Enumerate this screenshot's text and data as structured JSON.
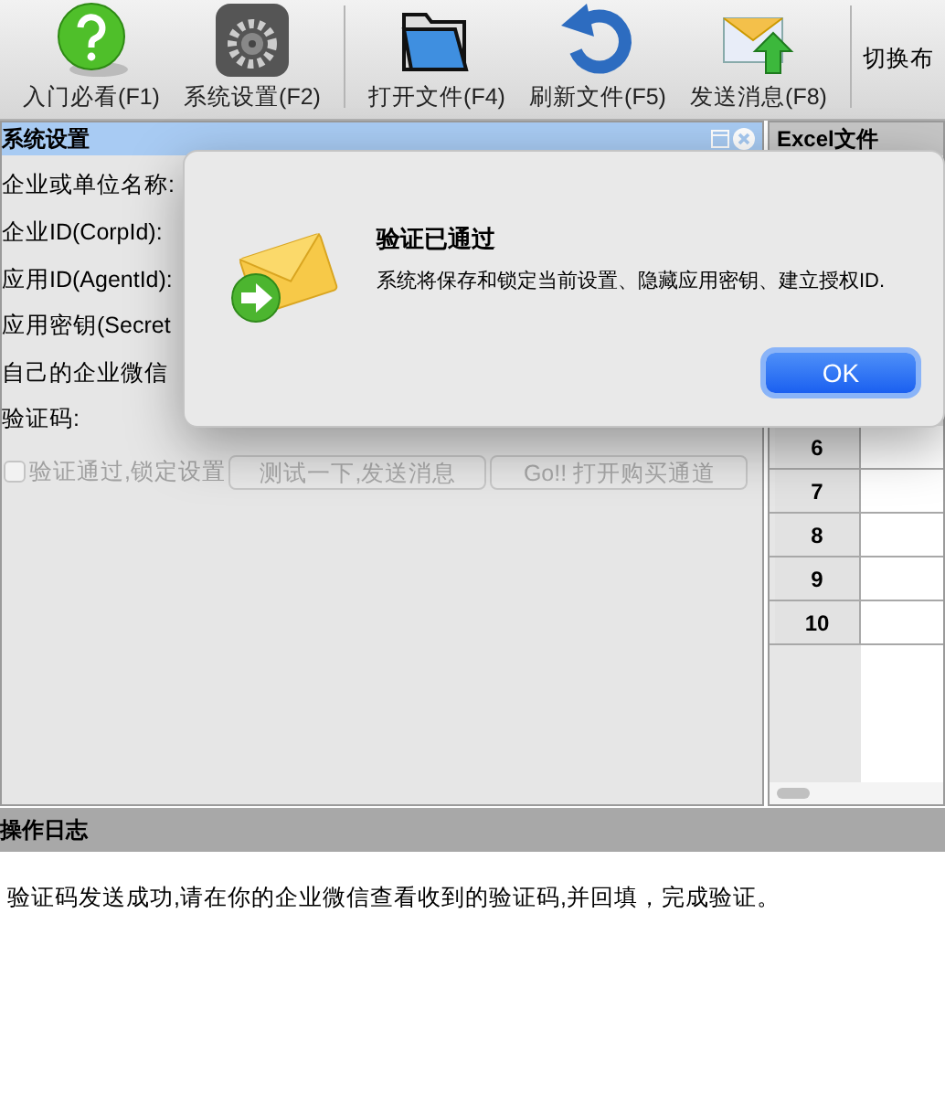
{
  "toolbar": {
    "buttons": [
      {
        "label": "入门必看(F1)",
        "kind": "help"
      },
      {
        "label": "系统设置(F2)",
        "kind": "settings"
      },
      {
        "label": "打开文件(F4)",
        "kind": "folder"
      },
      {
        "label": "刷新文件(F5)",
        "kind": "refresh"
      },
      {
        "label": "发送消息(F8)",
        "kind": "send"
      }
    ],
    "cut_label": "切换布"
  },
  "settings_panel": {
    "title": "系统设置",
    "fields": [
      {
        "label": "企业或单位名称:"
      },
      {
        "label": "企业ID(CorpId):"
      },
      {
        "label": "应用ID(AgentId):"
      },
      {
        "label": "应用密钥(Secret"
      },
      {
        "label": "自己的企业微信"
      },
      {
        "label": "验证码:"
      }
    ],
    "lock_checkbox": {
      "label": "验证通过,锁定设置",
      "checked": false,
      "disabled": true
    },
    "buttons": [
      {
        "label": "测试一下,发送消息",
        "disabled": true
      },
      {
        "label": "Go!! 打开购买通道",
        "disabled": true
      }
    ]
  },
  "excel_panel": {
    "title": "Excel文件",
    "row_numbers": [
      "6",
      "7",
      "8",
      "9",
      "10"
    ]
  },
  "log_panel": {
    "title": "操作日志",
    "lines": [
      "验证码发送成功,请在你的企业微信查看收到的验证码,并回填，完成验证。"
    ]
  },
  "dialog": {
    "title": "验证已通过",
    "message": "系统将保存和锁定当前设置、隐藏应用密钥、建立授权ID.",
    "button": "OK"
  }
}
